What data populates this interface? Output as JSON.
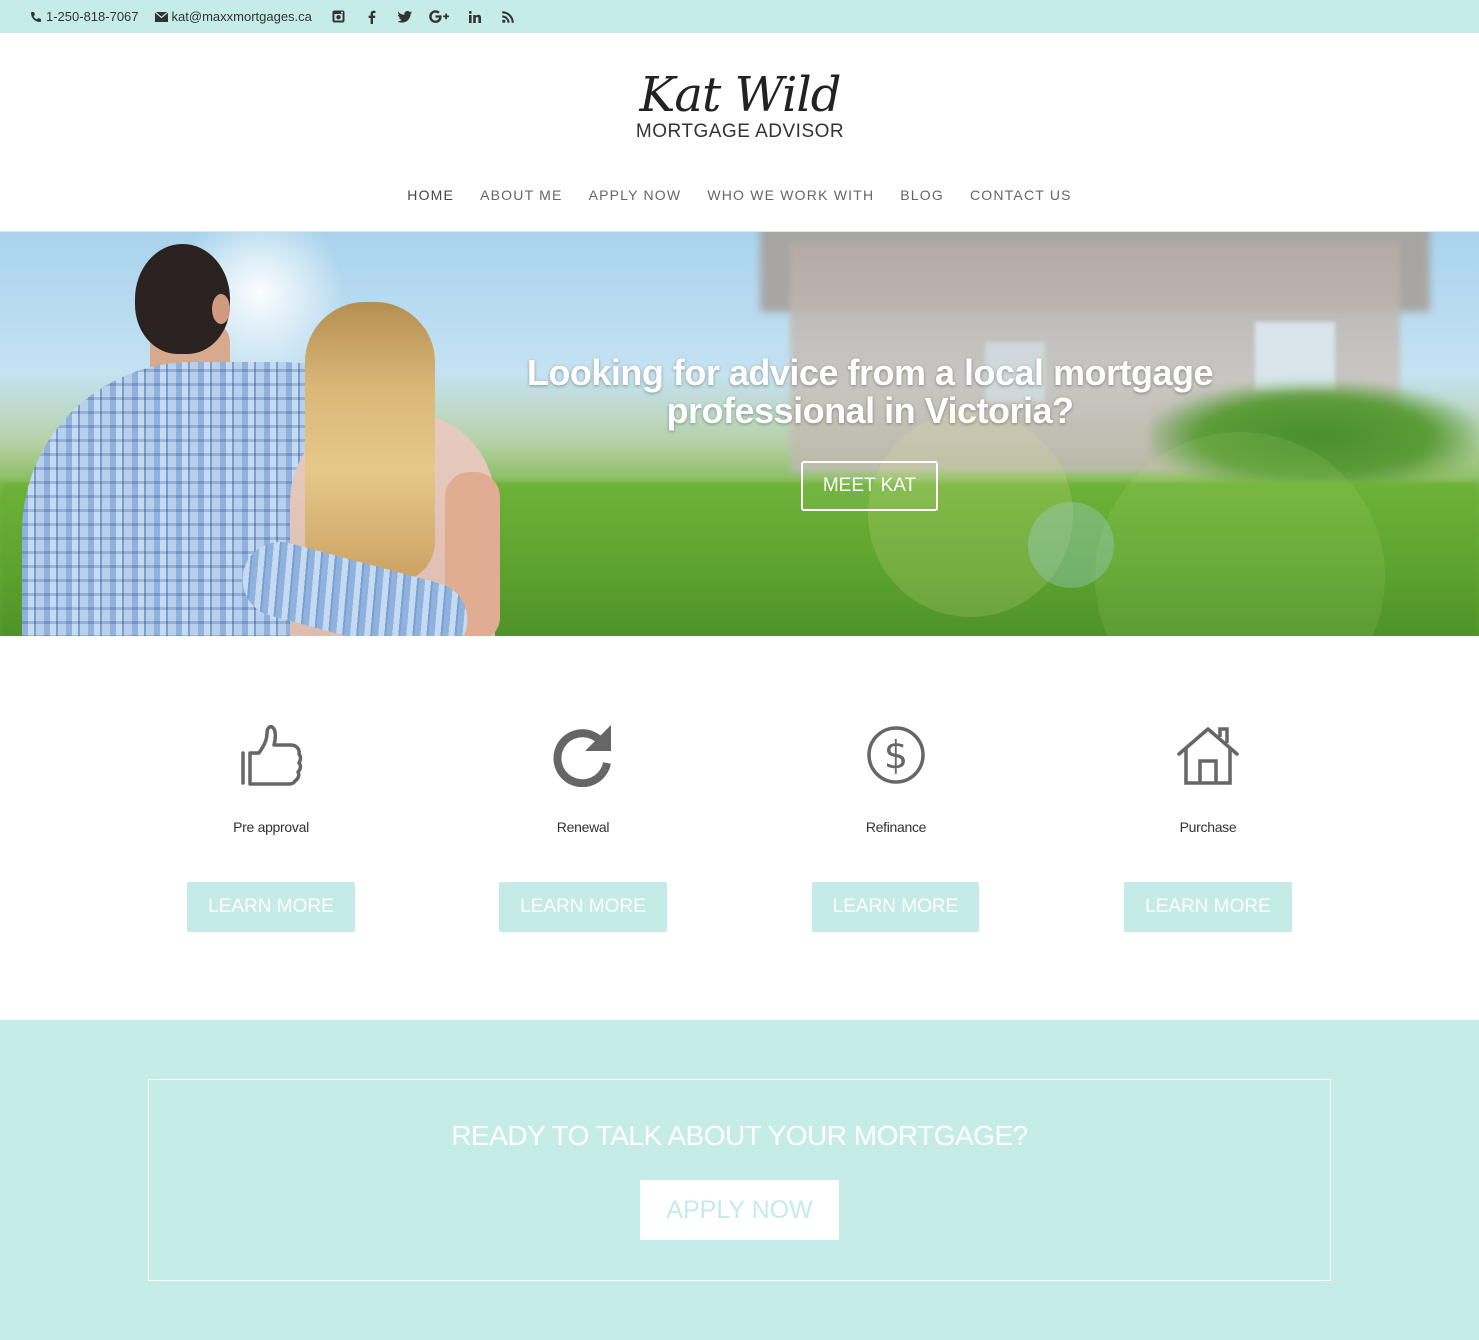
{
  "topbar": {
    "phone": "1-250-818-7067",
    "email": "kat@maxxmortgages.ca",
    "social": [
      {
        "icon": "instagram-icon",
        "glyph": "◙"
      },
      {
        "icon": "facebook-icon",
        "glyph": "f"
      },
      {
        "icon": "twitter-icon",
        "glyph": "🐦"
      },
      {
        "icon": "google-plus-icon",
        "glyph": "G+"
      },
      {
        "icon": "linkedin-icon",
        "glyph": "in"
      },
      {
        "icon": "rss-icon",
        "glyph": "◝"
      }
    ]
  },
  "header": {
    "logo_script": "Kat Wild",
    "logo_sub": "MORTGAGE ADVISOR",
    "nav": [
      {
        "label": "HOME",
        "active": true
      },
      {
        "label": "ABOUT ME"
      },
      {
        "label": "APPLY NOW"
      },
      {
        "label": "WHO WE WORK WITH"
      },
      {
        "label": "BLOG"
      },
      {
        "label": "CONTACT US"
      }
    ]
  },
  "hero": {
    "title": "Looking for advice from a local mortgage professional in Victoria?",
    "button": "MEET KAT"
  },
  "services": [
    {
      "label": "Pre approval",
      "icon": "thumbs-up-icon",
      "button": "LEARN MORE"
    },
    {
      "label": "Renewal",
      "icon": "refresh-icon",
      "button": "LEARN MORE"
    },
    {
      "label": "Refinance",
      "icon": "dollar-icon",
      "button": "LEARN MORE"
    },
    {
      "label": "Purchase",
      "icon": "house-icon",
      "button": "LEARN MORE"
    }
  ],
  "cta": {
    "title": "READY TO TALK ABOUT YOUR MORTGAGE?",
    "button": "APPLY NOW"
  },
  "colors": {
    "accent": "#c6ece7",
    "button": "#c4ebe6",
    "icon": "#666666"
  }
}
